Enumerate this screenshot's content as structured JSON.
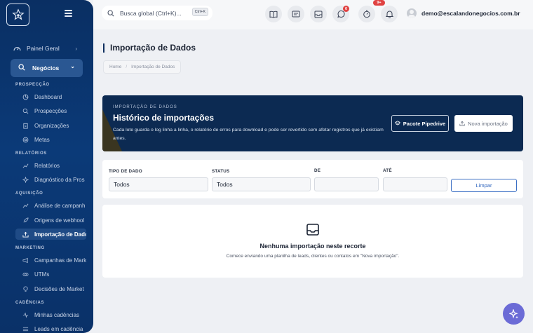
{
  "sidebar": {
    "general": {
      "label": "Painel Geral"
    },
    "business": {
      "label": "Negócios"
    },
    "sections": [
      {
        "label": "PROSPECÇÃO",
        "items": [
          "Dashboard",
          "Prospecções",
          "Organizações",
          "Metas"
        ]
      },
      {
        "label": "RELATÓRIOS",
        "items": [
          "Relatórios",
          "Diagnóstico da Pros"
        ]
      },
      {
        "label": "AQUISIÇÃO",
        "items": [
          "Análise de campanh",
          "Origens de webhool",
          "Importação de Dado"
        ]
      },
      {
        "label": "MARKETING",
        "items": [
          "Campanhas de Mark",
          "UTMs",
          "Decisões de Market"
        ]
      },
      {
        "label": "CADÊNCIAS",
        "items": [
          "Minhas cadências",
          "Leads em cadência"
        ]
      }
    ]
  },
  "topbar": {
    "search_placeholder": "Busca global (Ctrl+K)...",
    "search_shortcut": "Ctrl+K",
    "whatsapp_badge": "0",
    "notifications_badge": "9+",
    "user_email": "demo@escalandonegocios.com.br"
  },
  "page": {
    "title": "Importação de Dados",
    "breadcrumb": {
      "home": "Home",
      "current": "Importação de Dados"
    }
  },
  "hero": {
    "kicker": "IMPORTAÇÃO DE DADOS",
    "title": "Histórico de importações",
    "description": "Cada lote guarda o log linha a linha, o relatório de erros para download e pode ser revertido sem afetar registros que já existiam antes.",
    "pipedrive_label": "Pacote Pipedrive",
    "new_import_label": "Nova importação"
  },
  "filters": {
    "type_label": "TIPO DE DADO",
    "type_value": "Todos",
    "status_label": "STATUS",
    "status_value": "Todos",
    "from_label": "DE",
    "from_value": "",
    "to_label": "ATÉ",
    "to_value": "",
    "clear_label": "Limpar"
  },
  "empty": {
    "title": "Nenhuma importação neste recorte",
    "description": "Comece enviando uma planilha de leads, clientes ou contatos em \"Nova importação\"."
  },
  "colors": {
    "sidebar": "#0b3a78",
    "hero": "#0c2a52",
    "accent": "#2e64bd",
    "badge": "#e04242",
    "fab": "#6b6bd6"
  }
}
